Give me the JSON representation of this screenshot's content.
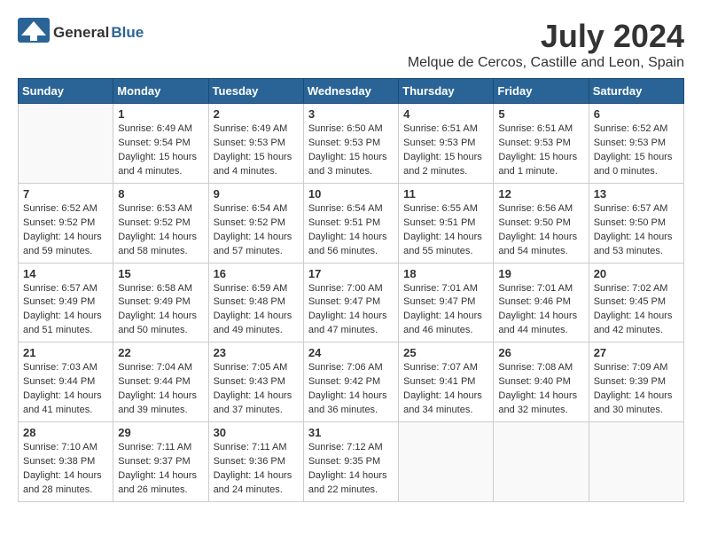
{
  "header": {
    "logo_general": "General",
    "logo_blue": "Blue",
    "month_year": "July 2024",
    "location": "Melque de Cercos, Castille and Leon, Spain"
  },
  "weekdays": [
    "Sunday",
    "Monday",
    "Tuesday",
    "Wednesday",
    "Thursday",
    "Friday",
    "Saturday"
  ],
  "weeks": [
    [
      {
        "day": "",
        "info": ""
      },
      {
        "day": "1",
        "info": "Sunrise: 6:49 AM\nSunset: 9:54 PM\nDaylight: 15 hours\nand 4 minutes."
      },
      {
        "day": "2",
        "info": "Sunrise: 6:49 AM\nSunset: 9:53 PM\nDaylight: 15 hours\nand 4 minutes."
      },
      {
        "day": "3",
        "info": "Sunrise: 6:50 AM\nSunset: 9:53 PM\nDaylight: 15 hours\nand 3 minutes."
      },
      {
        "day": "4",
        "info": "Sunrise: 6:51 AM\nSunset: 9:53 PM\nDaylight: 15 hours\nand 2 minutes."
      },
      {
        "day": "5",
        "info": "Sunrise: 6:51 AM\nSunset: 9:53 PM\nDaylight: 15 hours\nand 1 minute."
      },
      {
        "day": "6",
        "info": "Sunrise: 6:52 AM\nSunset: 9:53 PM\nDaylight: 15 hours\nand 0 minutes."
      }
    ],
    [
      {
        "day": "7",
        "info": "Sunrise: 6:52 AM\nSunset: 9:52 PM\nDaylight: 14 hours\nand 59 minutes."
      },
      {
        "day": "8",
        "info": "Sunrise: 6:53 AM\nSunset: 9:52 PM\nDaylight: 14 hours\nand 58 minutes."
      },
      {
        "day": "9",
        "info": "Sunrise: 6:54 AM\nSunset: 9:52 PM\nDaylight: 14 hours\nand 57 minutes."
      },
      {
        "day": "10",
        "info": "Sunrise: 6:54 AM\nSunset: 9:51 PM\nDaylight: 14 hours\nand 56 minutes."
      },
      {
        "day": "11",
        "info": "Sunrise: 6:55 AM\nSunset: 9:51 PM\nDaylight: 14 hours\nand 55 minutes."
      },
      {
        "day": "12",
        "info": "Sunrise: 6:56 AM\nSunset: 9:50 PM\nDaylight: 14 hours\nand 54 minutes."
      },
      {
        "day": "13",
        "info": "Sunrise: 6:57 AM\nSunset: 9:50 PM\nDaylight: 14 hours\nand 53 minutes."
      }
    ],
    [
      {
        "day": "14",
        "info": "Sunrise: 6:57 AM\nSunset: 9:49 PM\nDaylight: 14 hours\nand 51 minutes."
      },
      {
        "day": "15",
        "info": "Sunrise: 6:58 AM\nSunset: 9:49 PM\nDaylight: 14 hours\nand 50 minutes."
      },
      {
        "day": "16",
        "info": "Sunrise: 6:59 AM\nSunset: 9:48 PM\nDaylight: 14 hours\nand 49 minutes."
      },
      {
        "day": "17",
        "info": "Sunrise: 7:00 AM\nSunset: 9:47 PM\nDaylight: 14 hours\nand 47 minutes."
      },
      {
        "day": "18",
        "info": "Sunrise: 7:01 AM\nSunset: 9:47 PM\nDaylight: 14 hours\nand 46 minutes."
      },
      {
        "day": "19",
        "info": "Sunrise: 7:01 AM\nSunset: 9:46 PM\nDaylight: 14 hours\nand 44 minutes."
      },
      {
        "day": "20",
        "info": "Sunrise: 7:02 AM\nSunset: 9:45 PM\nDaylight: 14 hours\nand 42 minutes."
      }
    ],
    [
      {
        "day": "21",
        "info": "Sunrise: 7:03 AM\nSunset: 9:44 PM\nDaylight: 14 hours\nand 41 minutes."
      },
      {
        "day": "22",
        "info": "Sunrise: 7:04 AM\nSunset: 9:44 PM\nDaylight: 14 hours\nand 39 minutes."
      },
      {
        "day": "23",
        "info": "Sunrise: 7:05 AM\nSunset: 9:43 PM\nDaylight: 14 hours\nand 37 minutes."
      },
      {
        "day": "24",
        "info": "Sunrise: 7:06 AM\nSunset: 9:42 PM\nDaylight: 14 hours\nand 36 minutes."
      },
      {
        "day": "25",
        "info": "Sunrise: 7:07 AM\nSunset: 9:41 PM\nDaylight: 14 hours\nand 34 minutes."
      },
      {
        "day": "26",
        "info": "Sunrise: 7:08 AM\nSunset: 9:40 PM\nDaylight: 14 hours\nand 32 minutes."
      },
      {
        "day": "27",
        "info": "Sunrise: 7:09 AM\nSunset: 9:39 PM\nDaylight: 14 hours\nand 30 minutes."
      }
    ],
    [
      {
        "day": "28",
        "info": "Sunrise: 7:10 AM\nSunset: 9:38 PM\nDaylight: 14 hours\nand 28 minutes."
      },
      {
        "day": "29",
        "info": "Sunrise: 7:11 AM\nSunset: 9:37 PM\nDaylight: 14 hours\nand 26 minutes."
      },
      {
        "day": "30",
        "info": "Sunrise: 7:11 AM\nSunset: 9:36 PM\nDaylight: 14 hours\nand 24 minutes."
      },
      {
        "day": "31",
        "info": "Sunrise: 7:12 AM\nSunset: 9:35 PM\nDaylight: 14 hours\nand 22 minutes."
      },
      {
        "day": "",
        "info": ""
      },
      {
        "day": "",
        "info": ""
      },
      {
        "day": "",
        "info": ""
      }
    ]
  ]
}
